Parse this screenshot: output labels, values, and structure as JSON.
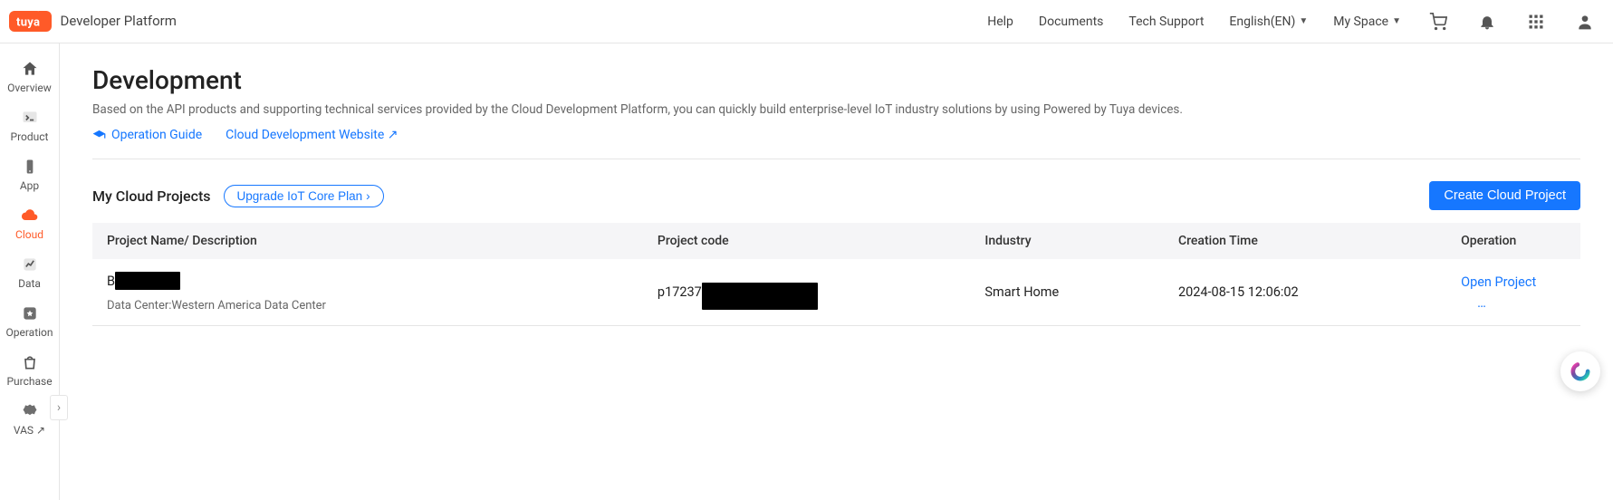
{
  "header": {
    "logo_text": "tuya",
    "brand_title": "Developer Platform",
    "nav": {
      "help": "Help",
      "docs": "Documents",
      "tech": "Tech Support",
      "lang": "English(EN)",
      "space": "My Space"
    }
  },
  "sidebar": {
    "items": [
      {
        "label": "Overview"
      },
      {
        "label": "Product"
      },
      {
        "label": "App"
      },
      {
        "label": "Cloud"
      },
      {
        "label": "Data"
      },
      {
        "label": "Operation"
      },
      {
        "label": "Purchase"
      },
      {
        "label": "VAS ↗"
      }
    ]
  },
  "page": {
    "title": "Development",
    "desc": "Based on the API products and supporting technical services provided by the Cloud Development Platform, you can quickly build enterprise-level IoT industry solutions by using Powered by Tuya devices.",
    "links": {
      "guide": "Operation Guide",
      "site": "Cloud Development Website ↗"
    }
  },
  "section": {
    "title": "My Cloud Projects",
    "upgrade": "Upgrade IoT Core Plan",
    "create": "Create Cloud Project"
  },
  "table": {
    "cols": {
      "name": "Project Name/ Description",
      "code": "Project code",
      "industry": "Industry",
      "ctime": "Creation Time",
      "op": "Operation"
    },
    "row": {
      "name_prefix": "B",
      "dc_label": "Data Center:",
      "dc_value": "Western America Data Center",
      "code_prefix": "p17237",
      "industry": "Smart Home",
      "ctime": "2024-08-15 12:06:02",
      "open": "Open Project",
      "more": "…"
    }
  }
}
